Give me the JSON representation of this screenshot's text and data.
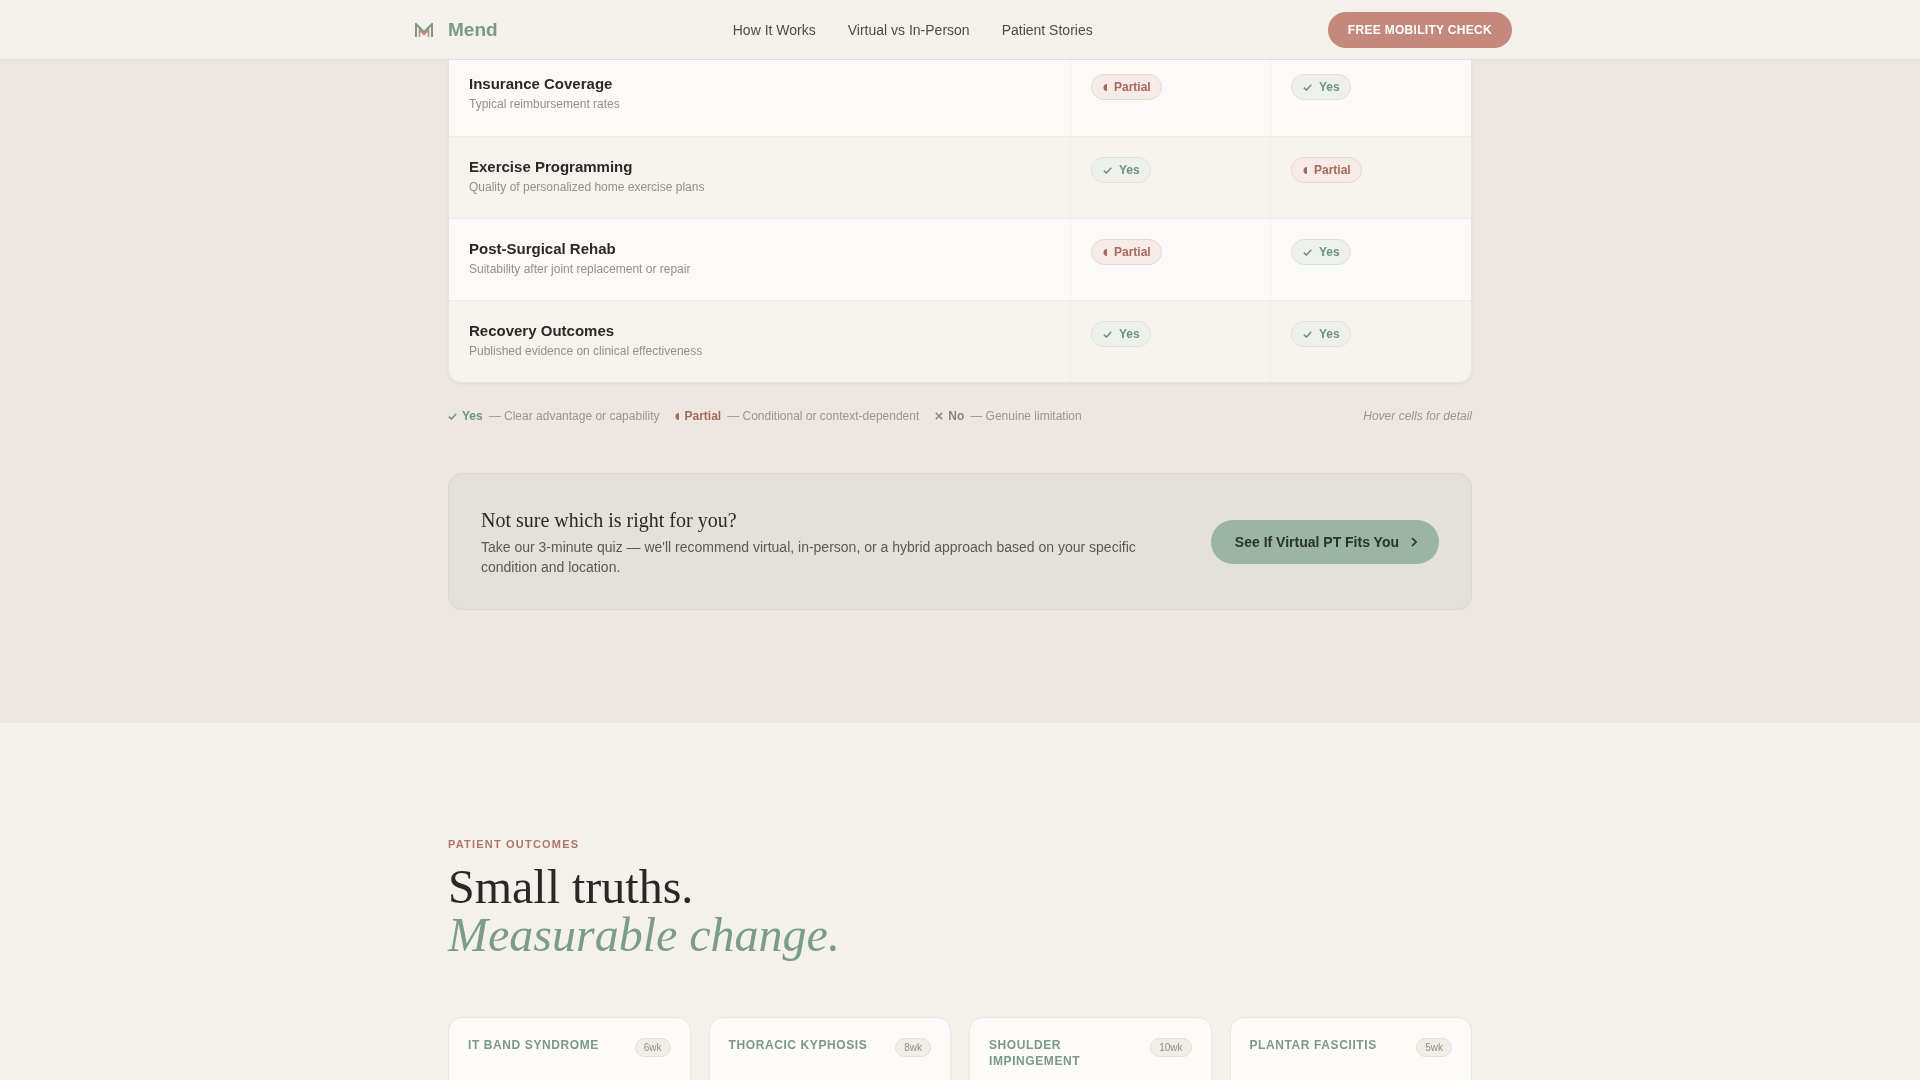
{
  "nav": {
    "brand": "Mend",
    "links": [
      "How It Works",
      "Virtual vs In-Person",
      "Patient Stories"
    ],
    "cta": "FREE MOBILITY CHECK"
  },
  "comparison": {
    "rows": [
      {
        "title": "Insurance Coverage",
        "subtitle": "Typical reimbursement rates",
        "cells": [
          {
            "kind": "partial",
            "label": "Partial"
          },
          {
            "kind": "yes",
            "label": "Yes"
          }
        ]
      },
      {
        "title": "Exercise Programming",
        "subtitle": "Quality of personalized home exercise plans",
        "cells": [
          {
            "kind": "yes",
            "label": "Yes"
          },
          {
            "kind": "partial",
            "label": "Partial"
          }
        ]
      },
      {
        "title": "Post-Surgical Rehab",
        "subtitle": "Suitability after joint replacement or repair",
        "cells": [
          {
            "kind": "partial",
            "label": "Partial"
          },
          {
            "kind": "yes",
            "label": "Yes"
          }
        ]
      },
      {
        "title": "Recovery Outcomes",
        "subtitle": "Published evidence on clinical effectiveness",
        "cells": [
          {
            "kind": "yes",
            "label": "Yes"
          },
          {
            "kind": "yes",
            "label": "Yes"
          }
        ]
      }
    ],
    "legend": [
      {
        "kind": "yes",
        "label": "Yes",
        "description": "— Clear advantage or capability"
      },
      {
        "kind": "partial",
        "label": "Partial",
        "description": "— Conditional or context-dependent"
      },
      {
        "kind": "no",
        "label": "No",
        "description": "— Genuine limitation"
      }
    ],
    "hint": "Hover cells for detail"
  },
  "quiz_prompt": {
    "title": "Not sure which is right for you?",
    "text": "Take our 3-minute quiz — we'll recommend virtual, in-person, or a hybrid approach based on your specific condition and location.",
    "button": "See If Virtual PT Fits You"
  },
  "outcomes": {
    "eyebrow": "PATIENT OUTCOMES",
    "heading": "Small truths.",
    "heading_accent": "Measurable change.",
    "cards": [
      {
        "title": "IT BAND SYNDROME",
        "duration": "6wk"
      },
      {
        "title": "THORACIC KYPHOSIS",
        "duration": "8wk"
      },
      {
        "title": "SHOULDER IMPINGEMENT",
        "duration": "10wk"
      },
      {
        "title": "PLANTAR FASCIITIS",
        "duration": "5wk"
      }
    ]
  }
}
